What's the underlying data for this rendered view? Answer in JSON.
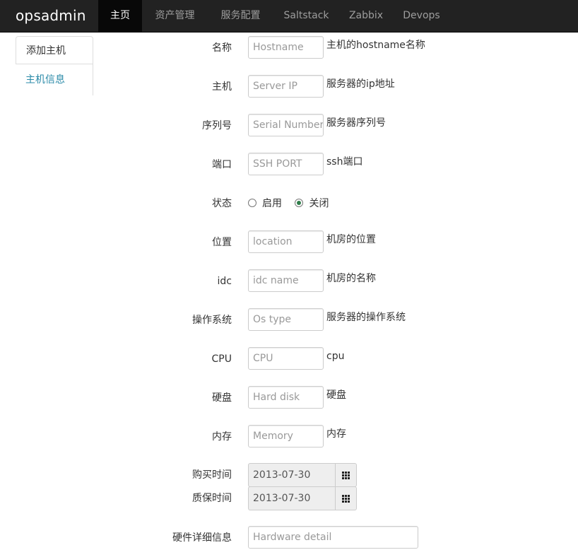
{
  "navbar": {
    "brand": "opsadmin",
    "items": [
      {
        "label": "主页",
        "active": true
      },
      {
        "label": "资产管理",
        "active": false
      },
      {
        "label": "服务配置",
        "active": false
      },
      {
        "label": "Saltstack",
        "active": false
      },
      {
        "label": "Zabbix",
        "active": false
      },
      {
        "label": "Devops",
        "active": false
      }
    ]
  },
  "sidebar": {
    "items": [
      {
        "label": "添加主机"
      },
      {
        "label": "主机信息"
      }
    ]
  },
  "form": {
    "hostname": {
      "label": "名称",
      "placeholder": "Hostname",
      "hint": "主机的hostname名称"
    },
    "host": {
      "label": "主机",
      "placeholder": "Server IP",
      "hint": "服务器的ip地址"
    },
    "serial": {
      "label": "序列号",
      "placeholder": "Serial Number",
      "hint": "服务器序列号"
    },
    "port": {
      "label": "端口",
      "placeholder": "SSH PORT",
      "hint": "ssh端口"
    },
    "status": {
      "label": "状态",
      "options": [
        {
          "label": "启用",
          "checked": false
        },
        {
          "label": "关闭",
          "checked": true
        }
      ]
    },
    "location": {
      "label": "位置",
      "placeholder": "location",
      "hint": "机房的位置"
    },
    "idc": {
      "label": "idc",
      "placeholder": "idc name",
      "hint": "机房的名称"
    },
    "os": {
      "label": "操作系统",
      "placeholder": "Os type",
      "hint": "服务器的操作系统"
    },
    "cpu": {
      "label": "CPU",
      "placeholder": "CPU",
      "hint": "cpu"
    },
    "disk": {
      "label": "硬盘",
      "placeholder": "Hard disk",
      "hint": "硬盘"
    },
    "memory": {
      "label": "内存",
      "placeholder": "Memory",
      "hint": "内存"
    },
    "purchase_date": {
      "label": "购买时间",
      "value": "2013-07-30"
    },
    "warranty_date": {
      "label": "质保时间",
      "value": "2013-07-30"
    },
    "hardware_detail": {
      "label": "硬件详细信息",
      "placeholder": "Hardware detail"
    }
  },
  "colors": {
    "navbar_bg": "#222222",
    "nav_active_bg": "#080808",
    "link": "#2a8aa8",
    "radio_checked": "#2f7d4a"
  }
}
